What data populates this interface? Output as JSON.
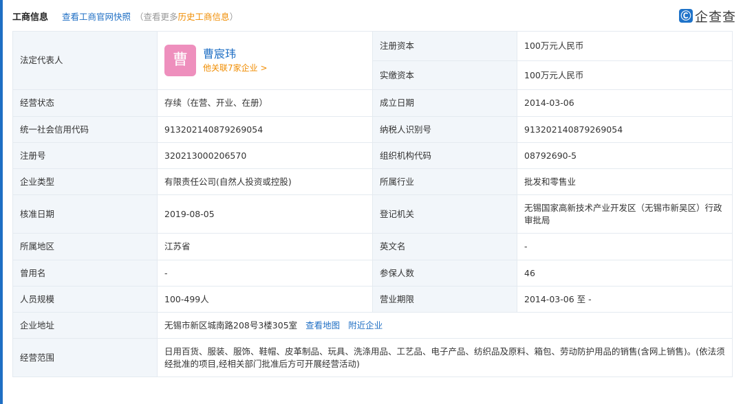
{
  "header": {
    "title": "工商信息",
    "snapshot_link": "查看工商官网快照",
    "history_prefix": "（查看更多",
    "history_highlight": "历史工商信息",
    "history_suffix": "）",
    "brand_icon_glyph": "Ⓒ",
    "brand_text": "企查查"
  },
  "legal": {
    "label": "法定代表人",
    "avatar_char": "曹",
    "name": "曹宸玮",
    "related": "他关联7家企业 >"
  },
  "rows": [
    {
      "l1": "法定代表人",
      "v1": "",
      "l2": "注册资本",
      "v2": "100万元人民币"
    },
    {
      "l1": "",
      "v1": "",
      "l2": "实缴资本",
      "v2": "100万元人民币"
    },
    {
      "l1": "经营状态",
      "v1": "存续（在营、开业、在册）",
      "l2": "成立日期",
      "v2": "2014-03-06"
    },
    {
      "l1": "统一社会信用代码",
      "v1": "91320214087926905​4",
      "l2": "纳税人识别号",
      "v2": "913202140879269054"
    },
    {
      "l1": "注册号",
      "v1": "320213000206570",
      "l2": "组织机构代码",
      "v2": "08792690-5"
    },
    {
      "l1": "企业类型",
      "v1": "有限责任公司(自然人投资或控股)",
      "l2": "所属行业",
      "v2": "批发和零售业"
    },
    {
      "l1": "核准日期",
      "v1": "2019-08-05",
      "l2": "登记机关",
      "v2": "无锡国家高新技术产业开发区（无锡市新吴区）行政审批局"
    },
    {
      "l1": "所属地区",
      "v1": "江苏省",
      "l2": "英文名",
      "v2": "-"
    },
    {
      "l1": "曾用名",
      "v1": "-",
      "l2": "参保人数",
      "v2": "46"
    },
    {
      "l1": "人员规模",
      "v1": "100-499人",
      "l2": "营业期限",
      "v2": "2014-03-06 至 -"
    }
  ],
  "address": {
    "label": "企业地址",
    "value": "无锡市新区城南路208号3楼305室",
    "map_link": "查看地图",
    "nearby_link": "附近企业"
  },
  "scope": {
    "label": "经营范围",
    "value": "日用百货、服装、服饰、鞋帽、皮革制品、玩具、洗涤用品、工艺品、电子产品、纺织品及原料、箱包、劳动防护用品的销售(含网上销售)。(依法须经批准的项目,经相关部门批准后方可开展经营活动)"
  }
}
